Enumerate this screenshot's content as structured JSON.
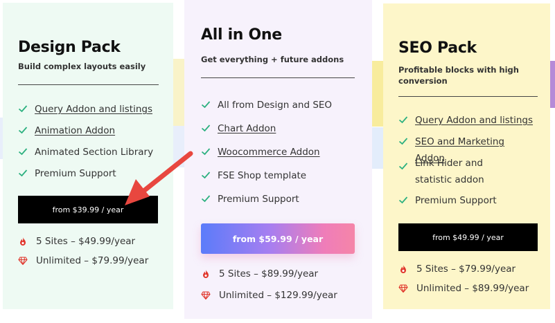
{
  "cards": {
    "design": {
      "title": "Design Pack",
      "subtitle": "Build complex layouts easily",
      "features": [
        {
          "text": "Query Addon and listings"
        },
        {
          "text": "Animation Addon"
        },
        {
          "text": "Animated Section Library"
        },
        {
          "text": "Premium Support"
        }
      ],
      "button": "from $39.99 / year",
      "tiers": [
        {
          "icon": "fire-icon",
          "text": "5 Sites – $49.99/year"
        },
        {
          "icon": "diamond-icon",
          "text": "Unlimited – $79.99/year"
        }
      ]
    },
    "allinone": {
      "title": "All in One",
      "subtitle": "Get everything + future addons",
      "features": [
        {
          "text": "All from Design and SEO"
        },
        {
          "text": "Chart Addon"
        },
        {
          "text": "Woocommerce Addon"
        },
        {
          "text": "FSE Shop template"
        },
        {
          "text": "Premium Support"
        }
      ],
      "button": "from $59.99 / year",
      "tiers": [
        {
          "icon": "fire-icon",
          "text": "5 Sites – $89.99/year"
        },
        {
          "icon": "diamond-icon",
          "text": "Unlimited – $129.99/year"
        }
      ]
    },
    "seo": {
      "title": "SEO Pack",
      "subtitle": "Profitable blocks with high conversion",
      "features": [
        {
          "text": "Query Addon and listings"
        },
        {
          "text": "SEO and Marketing Addon"
        },
        {
          "text": "Link Hider and statistic addon"
        },
        {
          "text": "Premium Support"
        }
      ],
      "button": "from $49.99 / year",
      "tiers": [
        {
          "icon": "fire-icon",
          "text": "5 Sites – $79.99/year"
        },
        {
          "icon": "diamond-icon",
          "text": "Unlimited – $89.99/year"
        }
      ]
    }
  },
  "colors": {
    "design_bg": "#eefaf3",
    "allinone_bg": "#f7f2fc",
    "seo_bg": "#fdf6c9",
    "check": "#2bb07f",
    "arrow": "#e8473f",
    "icon_red": "#e0352b"
  }
}
